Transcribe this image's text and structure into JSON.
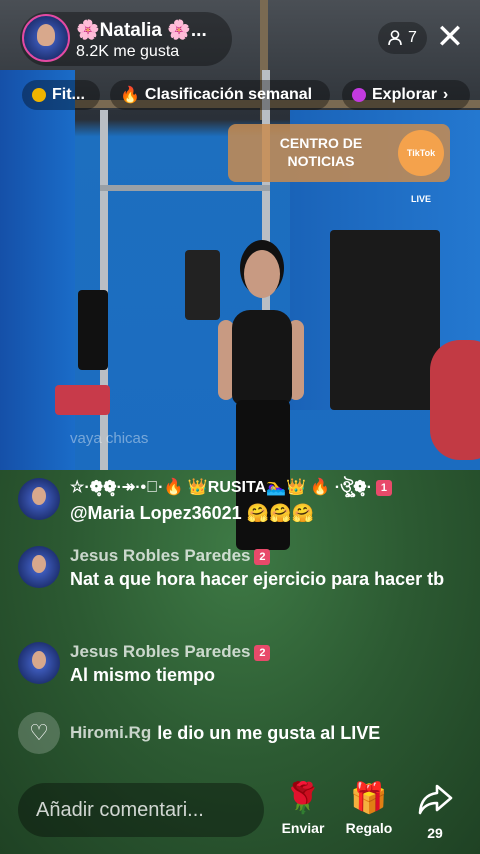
{
  "host": {
    "name": "🌸Natalia 🌸...",
    "likes": "8.2K me gusta"
  },
  "viewers": {
    "count": "7",
    "icon": "person-icon"
  },
  "nav_chips": [
    {
      "label": "Fit...",
      "icon_color": "#f0b400"
    },
    {
      "label": "Clasificación semanal",
      "icon": "flame-icon"
    },
    {
      "label": "Explorar",
      "icon_color": "#c23ae0"
    }
  ],
  "news_card": {
    "label": "CENTRO DE NOTICIAS",
    "badge": "TikTok LIVE"
  },
  "chat": {
    "faded_message": "vaya chicas",
    "decor_name": "☆·❁̥❁̥·↠·•⃝·🔥 👑RUSITA🏊‍♀️👑 🔥 ·ঔৣ❁̥·",
    "messages": [
      {
        "name": "",
        "text": "@Maria Lopez36021 🤗🤗🤗",
        "level": "1"
      },
      {
        "name": "Jesus Robles Paredes",
        "text": "Nat a que hora hacer ejercicio para hacer tb",
        "level": "2"
      },
      {
        "name": "Jesus Robles Paredes",
        "text": "Al mismo tiempo",
        "level": "2"
      }
    ],
    "like_event": {
      "name": "Hiromi.Rg",
      "text": "le dio un me gusta al LIVE"
    }
  },
  "bottom": {
    "comment_placeholder": "Añadir comentari...",
    "send_label": "Enviar",
    "gift_label": "Regalo",
    "share_count": "29"
  },
  "colors": {
    "accent": "#fe2c55",
    "news_card": "#c88c50"
  }
}
